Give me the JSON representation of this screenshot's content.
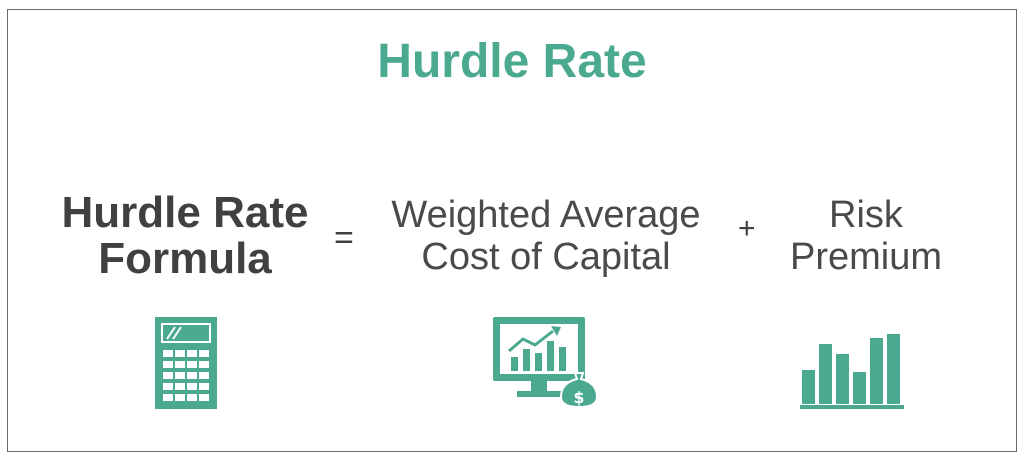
{
  "title": "Hurdle Rate",
  "formula": {
    "lhs_line1": "Hurdle Rate",
    "lhs_line2": "Formula",
    "equals": "=",
    "term1_line1": "Weighted Average",
    "term1_line2": "Cost of Capital",
    "plus": "+",
    "term2_line1": "Risk",
    "term2_line2": "Premium"
  },
  "icons": {
    "left": "calculator-icon",
    "middle": "monitor-growth-money-icon",
    "right": "bar-chart-icon"
  },
  "colors": {
    "accent": "#4aa98f",
    "text": "#404040",
    "border": "#6a6a6a"
  }
}
